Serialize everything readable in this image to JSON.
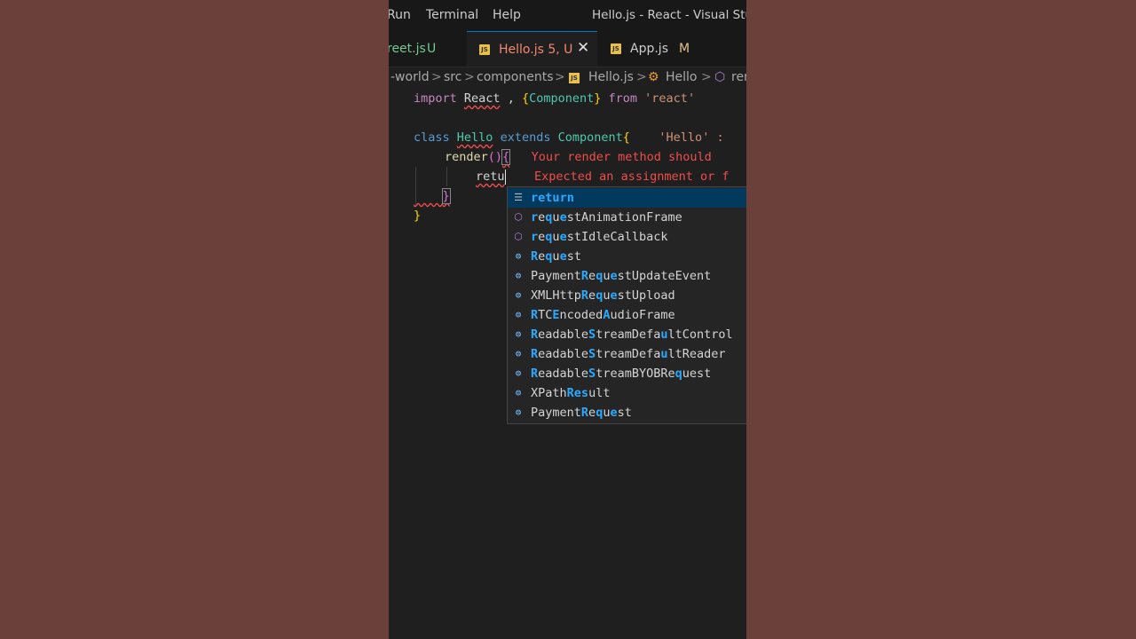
{
  "menu": {
    "run": "Run",
    "terminal": "Terminal",
    "help": "Help",
    "window_title": "Hello.js - React - Visual Studi"
  },
  "tabs": [
    {
      "name": "reet.js",
      "status": "U"
    },
    {
      "name": "Hello.js",
      "status": "5, U",
      "close": "✕"
    },
    {
      "name": "App.js",
      "status": "M"
    }
  ],
  "breadcrumb": {
    "root": "-world",
    "src": "src",
    "components": "components",
    "file": "Hello.js",
    "class": "Hello",
    "method": "ren",
    "sep": ">"
  },
  "code": {
    "l1": {
      "import": "import",
      "react": "React",
      "comma": " , ",
      "open": "{",
      "component": "Component",
      "close": "}",
      "from": " from ",
      "str": "'react'"
    },
    "l3": {
      "class": "class",
      "hello": "Hello",
      "extends": "extends",
      "component": "Component",
      "brace": "{",
      "hint": "'Hello' :"
    },
    "l4": {
      "render": "render",
      "parens": "()",
      "brace": "{",
      "err": "Your render method should"
    },
    "l5": {
      "typed": "retu",
      "err": "Expected an assignment or f"
    },
    "l6": {
      "brace": "}"
    },
    "l7": {
      "brace": "}"
    }
  },
  "suggestions": [
    {
      "icon": "keyword-icon",
      "glyph": "☰",
      "label": "return",
      "hl": [
        [
          0,
          4
        ]
      ]
    },
    {
      "icon": "method-icon",
      "glyph": "⬡",
      "label": "requestAnimationFrame",
      "hl": [
        [
          0,
          1
        ],
        [
          2,
          3
        ],
        [
          4,
          5
        ]
      ]
    },
    {
      "icon": "method-icon",
      "glyph": "⬡",
      "label": "requestIdleCallback",
      "hl": [
        [
          0,
          1
        ],
        [
          2,
          3
        ],
        [
          4,
          5
        ]
      ]
    },
    {
      "icon": "variable-icon",
      "glyph": "⊜",
      "label": "Request",
      "hl": [
        [
          0,
          1
        ],
        [
          2,
          3
        ],
        [
          4,
          5
        ]
      ]
    },
    {
      "icon": "variable-icon",
      "glyph": "⊜",
      "label": "PaymentRequestUpdateEvent",
      "hl": [
        [
          7,
          8
        ],
        [
          9,
          10
        ],
        [
          11,
          12
        ]
      ]
    },
    {
      "icon": "variable-icon",
      "glyph": "⊜",
      "label": "XMLHttpRequestUpload",
      "hl": [
        [
          7,
          8
        ],
        [
          9,
          10
        ],
        [
          11,
          12
        ]
      ]
    },
    {
      "icon": "variable-icon",
      "glyph": "⊜",
      "label": "RTCEncodedAudioFrame",
      "hl": [
        [
          0,
          1
        ],
        [
          3,
          4
        ],
        [
          10,
          11
        ]
      ]
    },
    {
      "icon": "variable-icon",
      "glyph": "⊜",
      "label": "ReadableStreamDefaultControl",
      "hl": [
        [
          0,
          1
        ],
        [
          8,
          9
        ],
        [
          18,
          19
        ]
      ]
    },
    {
      "icon": "variable-icon",
      "glyph": "⊜",
      "label": "ReadableStreamDefaultReader",
      "hl": [
        [
          0,
          1
        ],
        [
          8,
          9
        ],
        [
          18,
          19
        ]
      ]
    },
    {
      "icon": "variable-icon",
      "glyph": "⊜",
      "label": "ReadableStreamBYOBRequest",
      "hl": [
        [
          0,
          1
        ],
        [
          8,
          9
        ],
        [
          20,
          21
        ]
      ]
    },
    {
      "icon": "variable-icon",
      "glyph": "⊜",
      "label": "XPathResult",
      "hl": [
        [
          5,
          6
        ],
        [
          6,
          7
        ],
        [
          7,
          8
        ]
      ]
    },
    {
      "icon": "variable-icon",
      "glyph": "⊜",
      "label": "PaymentRequest",
      "hl": [
        [
          7,
          8
        ],
        [
          9,
          10
        ],
        [
          11,
          12
        ]
      ]
    }
  ],
  "colors": {
    "highlight": "#2aaaff",
    "error": "#f14c4c",
    "selected": "#04395e"
  }
}
